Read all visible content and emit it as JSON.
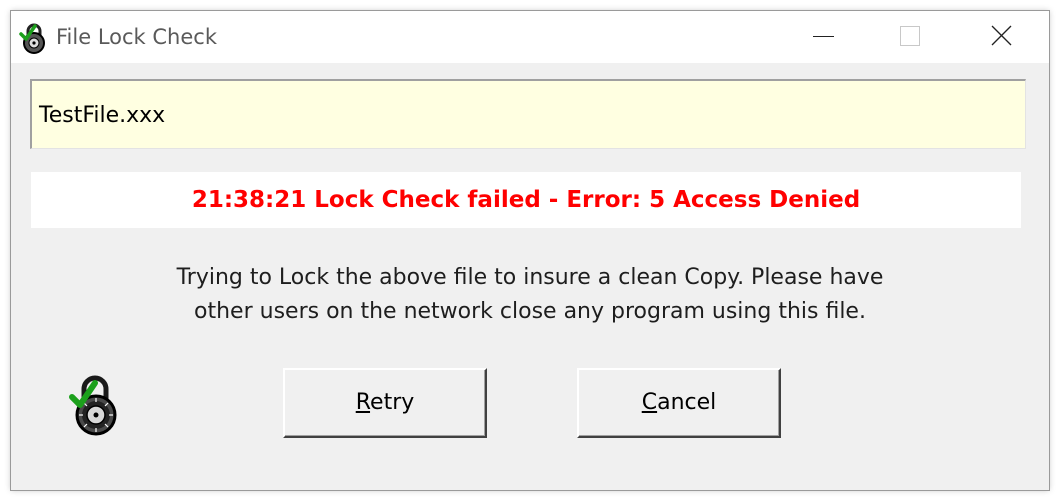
{
  "window": {
    "title": "File Lock Check",
    "controls": [
      "minimize",
      "maximize",
      "close"
    ]
  },
  "file_field": {
    "value": "TestFile.xxx"
  },
  "status": {
    "text": "21:38:21 Lock Check failed - Error: 5 Access Denied",
    "color": "#ff0000"
  },
  "message": {
    "line1": "Trying to Lock the above file to insure a clean Copy. Please have",
    "line2": "other users on the network close any program using this file."
  },
  "buttons": {
    "retry": {
      "mnemonic": "R",
      "rest": "etry"
    },
    "cancel": {
      "mnemonic": "C",
      "rest": "ancel"
    }
  },
  "icons": {
    "app": "lock-check-icon",
    "dialog": "lock-check-icon",
    "check_color": "#1ca01c"
  }
}
